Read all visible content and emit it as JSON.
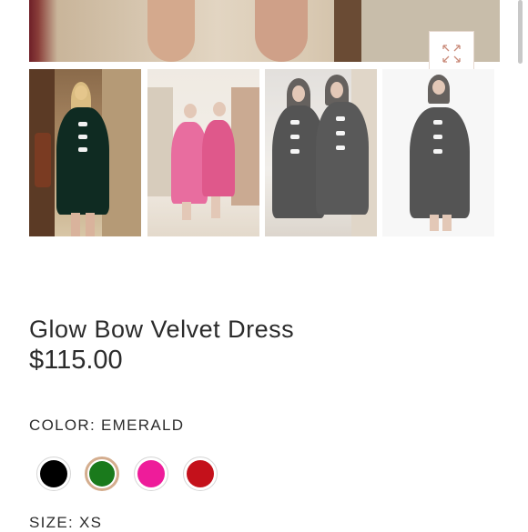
{
  "product": {
    "title": "Glow Bow Velvet Dress",
    "price": "$115.00",
    "color_label": "COLOR: EMERALD",
    "size_label": "SIZE: XS"
  },
  "gallery": {
    "expand_icon": "expand-arrows-icon",
    "thumbnails": [
      {
        "name": "emerald-dress-photo",
        "state": "selected"
      },
      {
        "name": "pink-and-red-dresses-photo",
        "state": "dimmed"
      },
      {
        "name": "two-black-dresses-photo",
        "state": "dimmed"
      },
      {
        "name": "black-dress-studio-photo",
        "state": "dimmed"
      }
    ]
  },
  "swatches": [
    {
      "name": "black",
      "color": "#000000",
      "selected": false
    },
    {
      "name": "emerald",
      "color": "#1a7a1c",
      "selected": true
    },
    {
      "name": "pink",
      "color": "#ee1c9a",
      "selected": false
    },
    {
      "name": "red",
      "color": "#c4111b",
      "selected": false
    }
  ]
}
